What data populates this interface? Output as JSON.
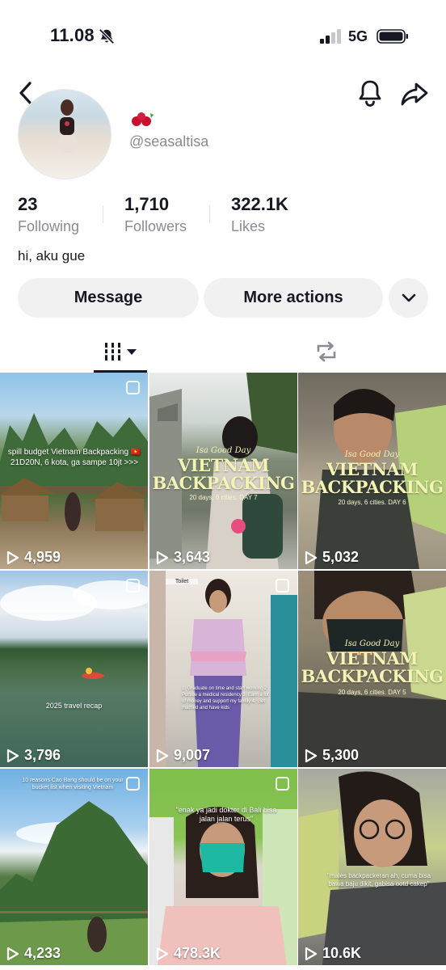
{
  "status_bar": {
    "time": "11.08",
    "network": "5G"
  },
  "profile": {
    "username": "@seasaltisa",
    "bio": "hi, aku gue",
    "stats": [
      {
        "value": "23",
        "label": "Following"
      },
      {
        "value": "1,710",
        "label": "Followers"
      },
      {
        "value": "322.1K",
        "label": "Likes"
      }
    ]
  },
  "actions": {
    "message": "Message",
    "more": "More actions"
  },
  "videos": [
    {
      "views": "4,959",
      "caption": "spill budget Vietnam Backpacking 🇻🇳 21D20N, 6 kota, ga sampe 10jt >>>"
    },
    {
      "views": "3,643",
      "title_top": "Isa Good Day",
      "title": "VIETNAM BACKPACKING",
      "subtitle": "20 days, 6 cities. DAY 7"
    },
    {
      "views": "5,032",
      "title_top": "Isa Good Day",
      "title": "VIETNAM BACKPACKING",
      "subtitle": "20 days, 6 cities. DAY 6"
    },
    {
      "views": "3,796",
      "caption": "2025 travel recap"
    },
    {
      "views": "9,007",
      "sign": "Toilet",
      "caption": "1. Graduate on time and start working 2. Pursue a medical residency 3. Earn a lot of money and support my family 4. Get married and have kids"
    },
    {
      "views": "5,300",
      "title_top": "Isa Good Day",
      "title": "VIETNAM BACKPACKING",
      "subtitle": "20 days, 6 cities. DAY 5"
    },
    {
      "views": "4,233",
      "caption": "10 reasons Cao Bang should be on your bucket list when visiting Vietnam"
    },
    {
      "views": "478.3K",
      "caption": "\"enak ya jadi dokter di Bali bisa jalan jalan terus\""
    },
    {
      "views": "10.6K",
      "caption": "\"males backpackeran ah, cuma bisa bawa baju dikit, gabisa ootd cakep\""
    }
  ]
}
